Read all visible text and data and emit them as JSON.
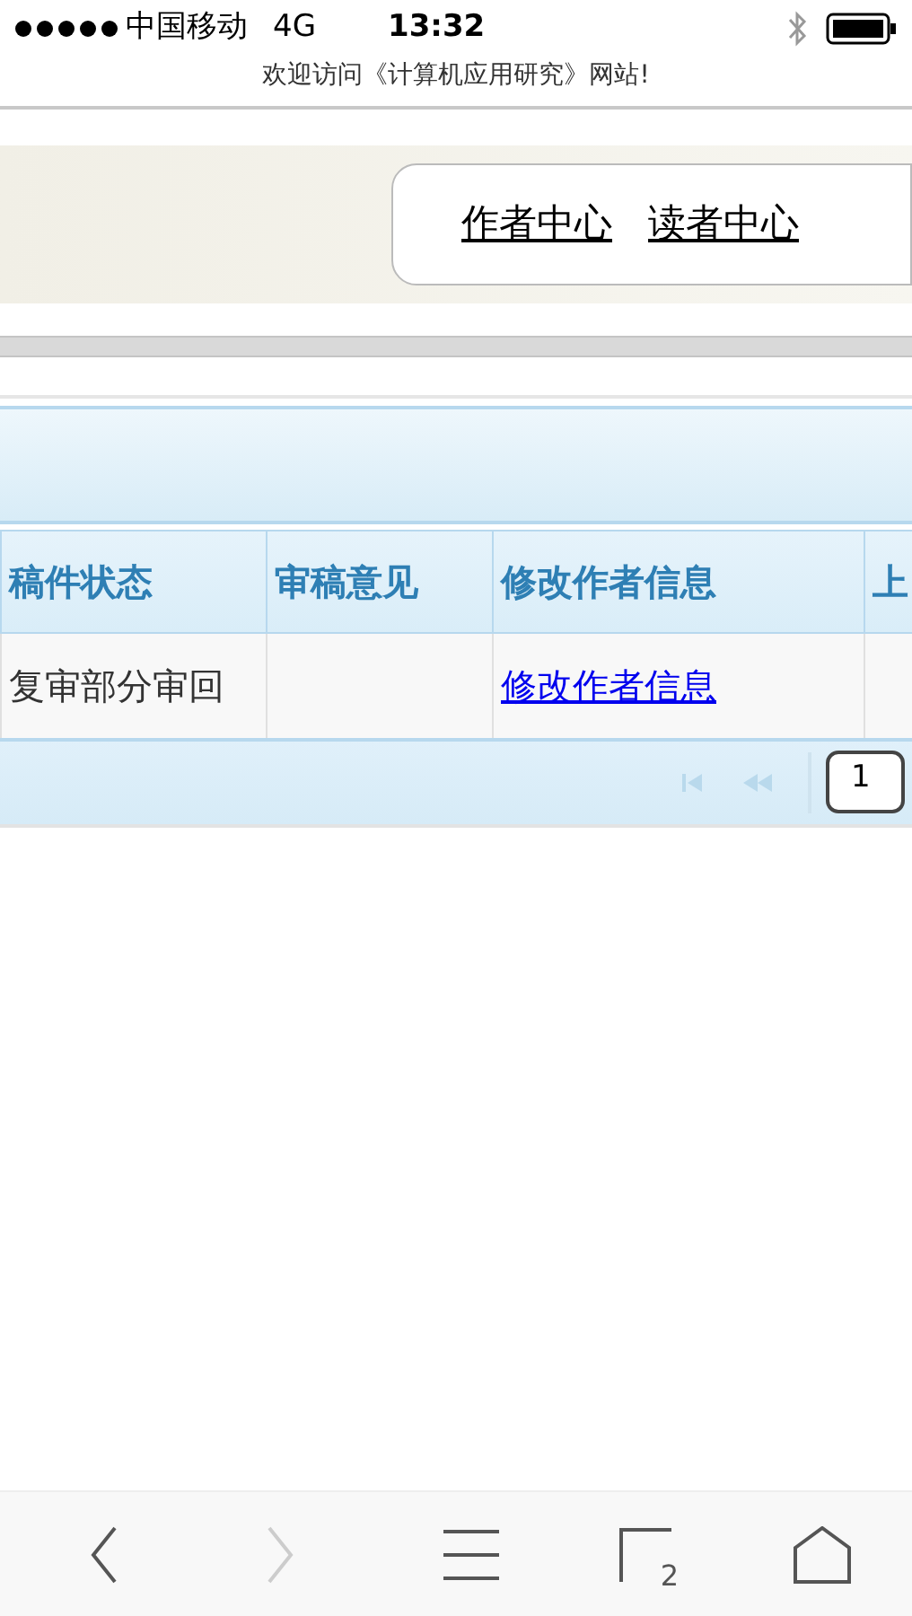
{
  "status_bar": {
    "carrier": "中国移动",
    "network": "4G",
    "time": "13:32",
    "page_title": "欢迎访问《计算机应用研究》网站!"
  },
  "header_links": [
    {
      "label": "作者中心"
    },
    {
      "label": "读者中心"
    }
  ],
  "table": {
    "columns": [
      "稿件状态",
      "审稿意见",
      "修改作者信息",
      "上"
    ],
    "rows": [
      {
        "cells": [
          {
            "kind": "text",
            "text": "复审部分审回"
          },
          {
            "kind": "empty"
          },
          {
            "kind": "link",
            "text": "修改作者信息"
          },
          {
            "kind": "empty"
          }
        ]
      }
    ]
  },
  "pager": {
    "first_disabled": true,
    "prev_disabled": true,
    "page": "1"
  },
  "browser_toolbar": {
    "back_disabled": false,
    "forward_disabled": true,
    "tab_count": "2"
  }
}
